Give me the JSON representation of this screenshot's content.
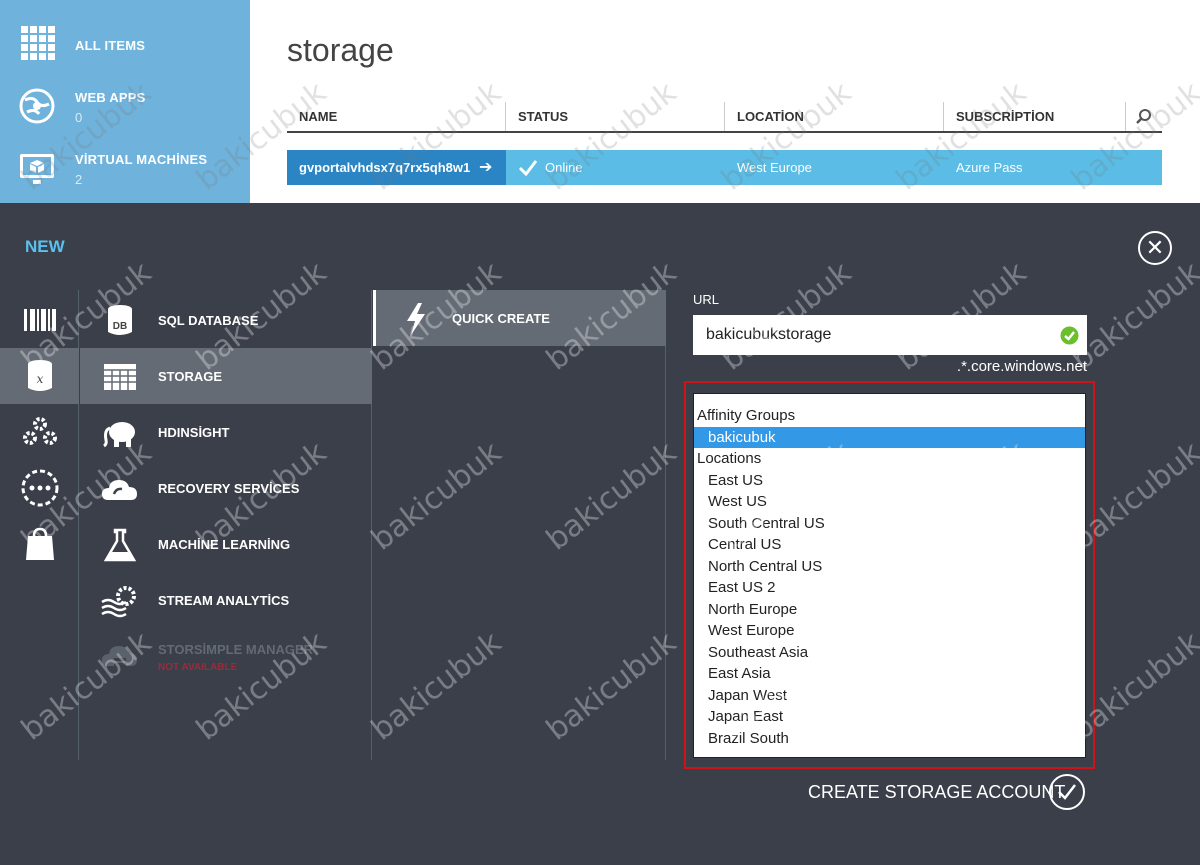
{
  "left_nav": {
    "items": [
      {
        "label": "ALL ITEMS",
        "count": ""
      },
      {
        "label": "WEB APPS",
        "count": "0"
      },
      {
        "label": "VİRTUAL MACHİNES",
        "count": "2"
      }
    ]
  },
  "page": {
    "title": "storage"
  },
  "table": {
    "columns": [
      "NAME",
      "STATUS",
      "LOCATİON",
      "SUBSCRİPTİON"
    ],
    "rows": [
      {
        "name": "gvportalvhdsx7q7rx5qh8w1",
        "status": "Online",
        "location": "West Europe",
        "subscription": "Azure Pass"
      }
    ]
  },
  "new_panel": {
    "title": "NEW",
    "services": [
      {
        "label": "SQL DATABASE"
      },
      {
        "label": "STORAGE"
      },
      {
        "label": "HDINSİGHT"
      },
      {
        "label": "RECOVERY SERVİCES"
      },
      {
        "label": "MACHİNE LEARNİNG"
      },
      {
        "label": "STREAM ANALYTİCS"
      },
      {
        "label": "STORSİMPLE MANAGER",
        "sub": "NOT AVAILABLE"
      }
    ],
    "quick_create": "QUICK CREATE",
    "form": {
      "url_label": "URL",
      "url_value": "bakicubukstorage",
      "url_suffix": ".*.core.windows.net",
      "region_groups": [
        {
          "label": "Affinity Groups",
          "options": [
            "bakicubuk"
          ]
        },
        {
          "label": "Locations",
          "options": [
            "East US",
            "West US",
            "South Central US",
            "Central US",
            "North Central US",
            "East US 2",
            "North Europe",
            "West Europe",
            "Southeast Asia",
            "East Asia",
            "Japan West",
            "Japan East",
            "Brazil South"
          ]
        }
      ],
      "selected_region": "bakicubuk",
      "create_label": "CREATE STORAGE ACCOUNT"
    }
  },
  "watermark": "bakicubuk",
  "colors": {
    "nav_bg": "#6fb2db",
    "row_bg": "#5bbde6",
    "row_name_bg": "#2b85c4",
    "panel_bg": "#3a3f4a",
    "accent": "#5bc0f0",
    "highlight_frame": "#d0121b"
  }
}
